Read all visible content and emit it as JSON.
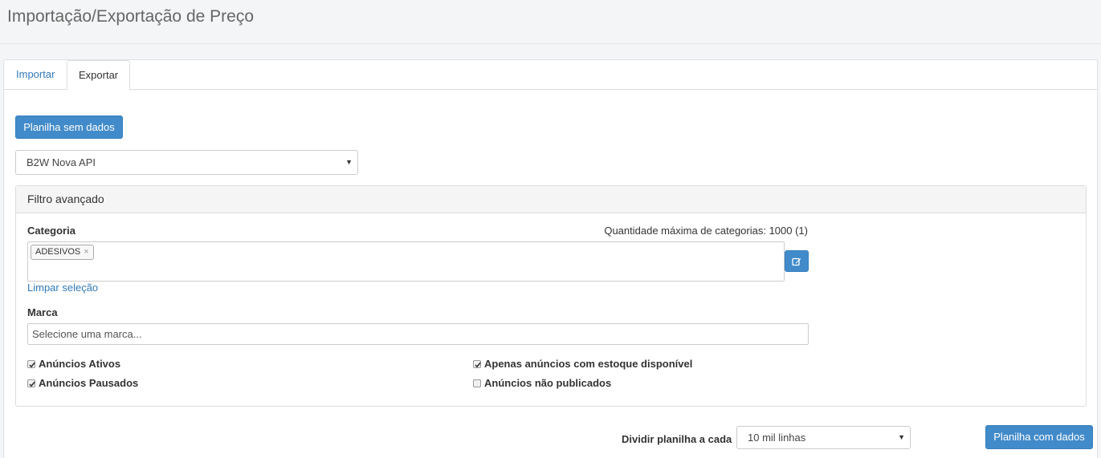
{
  "page": {
    "title": "Importação/Exportação de Preço"
  },
  "tabs": [
    {
      "label": "Importar",
      "active": false
    },
    {
      "label": "Exportar",
      "active": true
    }
  ],
  "export": {
    "empty_sheet_button": "Planilha sem dados",
    "marketplace_select": {
      "value": "B2W Nova API"
    },
    "advanced_filter": {
      "title": "Filtro avançado",
      "category": {
        "label": "Categoria",
        "max_text": "Quantidade máxima de categorias: 1000 (1)",
        "selected_tags": [
          "ADESIVOS"
        ],
        "tag_remove_glyph": "×",
        "clear_link": "Limpar seleção",
        "edit_icon": "edit-icon"
      },
      "brand": {
        "label": "Marca",
        "placeholder": "Selecione uma marca..."
      },
      "checkboxes": {
        "active_ads": {
          "label": "Anúncios Ativos",
          "checked": true
        },
        "paused_ads": {
          "label": "Anúncios Pausados",
          "checked": true
        },
        "stock_only": {
          "label": "Apenas anúncios com estoque disponível",
          "checked": true
        },
        "unpublished_ads": {
          "label": "Anúncios não publicados",
          "checked": false
        }
      }
    },
    "split": {
      "label": "Dividir planilha a cada",
      "value": "10 mil linhas"
    },
    "with_data_button": "Planilha com dados"
  },
  "colors": {
    "primary": "#428bca",
    "link": "#337ab7"
  }
}
